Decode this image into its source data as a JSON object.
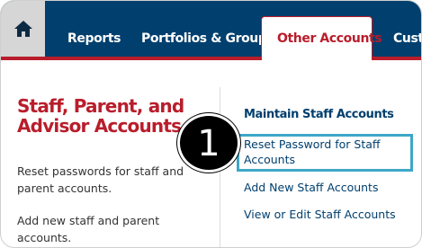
{
  "nav": {
    "home_icon": "home-icon",
    "items": [
      "Reports",
      "Portfolios & Groups",
      "Other Accounts",
      "Custo"
    ],
    "active_index": 2
  },
  "left": {
    "title": "Staff, Parent, and Advisor Accounts",
    "descriptions": [
      "Reset passwords for staff and parent accounts.",
      "Add new staff and parent accounts."
    ]
  },
  "right": {
    "heading": "Maintain Staff Accounts",
    "links": [
      "Reset Password for Staff Accounts",
      "Add New Staff Accounts",
      "View or Edit Staff Accounts"
    ],
    "highlighted_index": 0
  },
  "step_badge": "1",
  "colors": {
    "nav_background": "#003f6e",
    "active_tab_accent": "#b91d2b",
    "title_red": "#b91d2b",
    "link_blue": "#003f6e",
    "highlight_teal": "#3da7c7",
    "home_tab_gray": "#d6d6d6"
  }
}
